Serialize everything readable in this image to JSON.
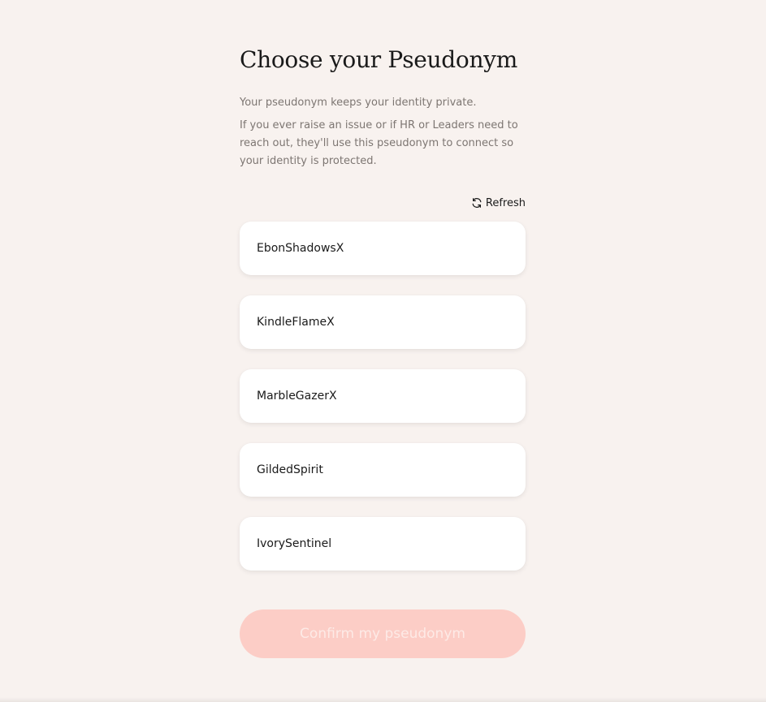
{
  "header": {
    "title": "Choose your Pseudonym",
    "subtitle": "Your pseudonym keeps your identity private.",
    "description": "If you ever raise an issue or if HR or Leaders need to reach out, they'll use this pseudonym to connect so your identity is protected."
  },
  "refresh": {
    "label": "Refresh",
    "icon": "refresh-icon"
  },
  "options": [
    {
      "name": "EbonShadowsX"
    },
    {
      "name": "KindleFlameX"
    },
    {
      "name": "MarbleGazerX"
    },
    {
      "name": "GildedSpirit"
    },
    {
      "name": "IvorySentinel"
    }
  ],
  "confirm": {
    "label": "Confirm my pseudonym",
    "disabled": true
  },
  "colors": {
    "background": "#f8f2ef",
    "card": "#ffffff",
    "accent_disabled": "#fccdc6",
    "muted_text": "#7d7672"
  }
}
